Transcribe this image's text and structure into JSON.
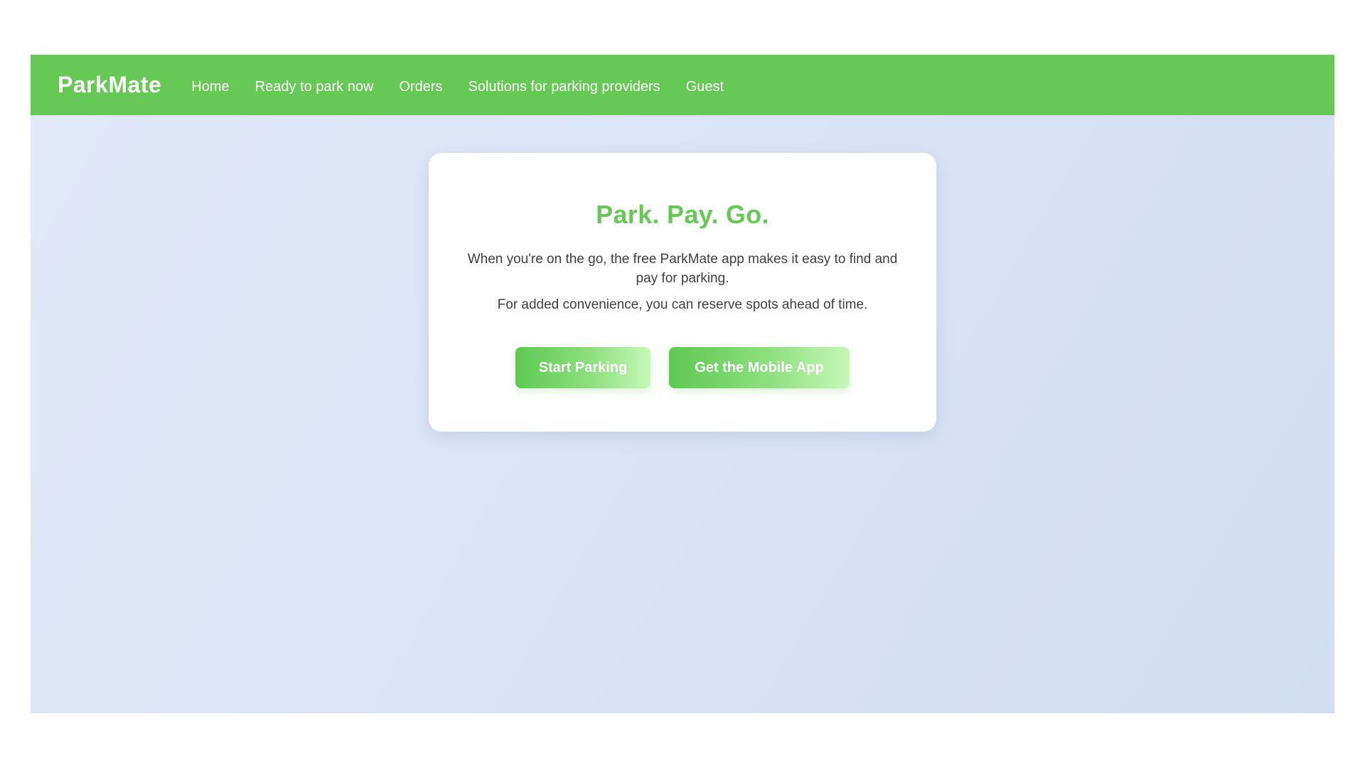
{
  "navbar": {
    "brand": "ParkMate",
    "links": [
      {
        "label": "Home"
      },
      {
        "label": "Ready to park now"
      },
      {
        "label": "Orders"
      },
      {
        "label": "Solutions for parking providers"
      },
      {
        "label": "Guest"
      }
    ]
  },
  "hero": {
    "title": "Park. Pay. Go.",
    "paragraph1": "When you're on the go, the free ParkMate app makes it easy to find and pay for parking.",
    "paragraph2": "For added convenience, you can reserve spots ahead of time.",
    "primary_button": "Start Parking",
    "secondary_button": "Get the Mobile App"
  },
  "colors": {
    "brand_green": "#66c955",
    "background": "#dbe4f5",
    "text": "#404040"
  }
}
